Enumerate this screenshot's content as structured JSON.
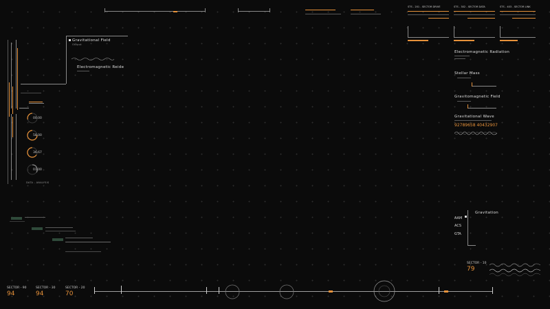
{
  "left_panel": {
    "gauges": [
      {
        "value": "00.00"
      },
      {
        "value": "58.00"
      },
      {
        "value": "36.67"
      },
      {
        "value": "01.00"
      }
    ],
    "data_label": "DATA - ANALYSIS"
  },
  "field_panel": {
    "title": "Gravitational Field",
    "subtitle": "Output",
    "sub_title": "Electromagnetic Reide"
  },
  "status_cards": [
    {
      "title": "STS - 201 - SECTOR DRIVE"
    },
    {
      "title": "STS - 302 - SECTOR DATA"
    },
    {
      "title": "STS - 403 - SECTOR LINK"
    }
  ],
  "right_panel": {
    "items": [
      {
        "title": "Electromagnetic Radiation"
      },
      {
        "title": "Stellar Mass"
      },
      {
        "title": "Gravitomagnetic Field"
      },
      {
        "title": "Gravitational Wave"
      }
    ],
    "wave_number": "92789658 40432907"
  },
  "grav_chart": {
    "title": "Gravitation",
    "labels": [
      "AAM",
      "ACS",
      "GTA"
    ]
  },
  "sector_right": {
    "name": "SECTOR - 10",
    "value": "79"
  },
  "sectors_bottom": [
    {
      "name": "SECTOR - 90",
      "value": "94"
    },
    {
      "name": "SECTOR - 30",
      "value": "94"
    },
    {
      "name": "SECTOR - 20",
      "value": "70"
    }
  ],
  "colors": {
    "accent": "#e8923a",
    "line": "#8a8a8a",
    "bg": "#0b0b0b",
    "pill": "#2f4a3a"
  }
}
